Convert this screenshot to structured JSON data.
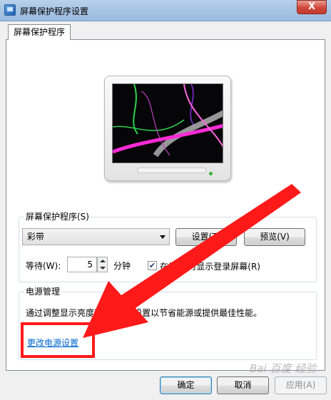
{
  "window": {
    "title": "屏幕保护程序设置",
    "close_glyph": "X"
  },
  "tab": {
    "label": "屏幕保护程序"
  },
  "screen_saver": {
    "group_label": "屏幕保护程序(S)",
    "selected": "彩带",
    "settings_button": "设置(T)",
    "preview_button": "预览(V)",
    "wait_label": "等待(W):",
    "wait_value": "5",
    "minutes_label": "分钟",
    "logon_checkbox_checked": true,
    "logon_checkbox_label": "在恢复时显示登录屏幕(R)",
    "logon_checkbox_visible_label": "在恢    时显示登录屏幕(R)"
  },
  "power": {
    "group_label": "电源管理",
    "description": "通过调整显示亮度和其他电源设置以节省能源或提供最佳性能。",
    "description_visible": "通过调整显示亮度和     电源设置以节省能源或提供最佳性能。",
    "link": "更改电源设置"
  },
  "buttons": {
    "ok": "确定",
    "cancel": "取消",
    "apply": "应用(A)"
  },
  "watermark": "Bai 百度 经验",
  "colors": {
    "annotation_red": "#ff1a1a",
    "link_blue": "#0066cc",
    "ribbon_magenta": "#ff2bd6",
    "ribbon_green": "#30d050"
  },
  "icons": {
    "app": "screen-saver-app-icon",
    "close": "close-icon",
    "dropdown": "chevron-down-icon"
  }
}
